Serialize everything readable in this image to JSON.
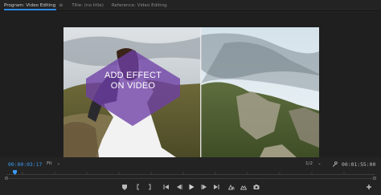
{
  "tabs": [
    {
      "label": "Program: Video Editing",
      "active": true
    },
    {
      "label": "Title: (no title)",
      "active": false
    },
    {
      "label": "Reference: Video Editing",
      "active": false
    }
  ],
  "overlay": {
    "line1": "ADD EFFECT",
    "line2": "ON VIDEO"
  },
  "timecode": {
    "current": "00:00:03:17",
    "duration": "00:01:55:00"
  },
  "fit": {
    "value": "Fit",
    "chevron": "chevron-down-icon"
  },
  "resolution": {
    "value": "1/2",
    "chevron": "chevron-down-icon"
  },
  "controls": [
    "add-marker-icon",
    "mark-in-icon",
    "mark-out-icon",
    "go-to-in-icon",
    "step-back-icon",
    "play-icon",
    "step-forward-icon",
    "go-to-out-icon",
    "lift-icon",
    "extract-icon",
    "export-frame-icon",
    "add-button-icon"
  ],
  "colors": {
    "accent": "#2d8ceb",
    "timecode_current": "#3b9cf5",
    "overlay_shape": "#7a4bb0"
  }
}
